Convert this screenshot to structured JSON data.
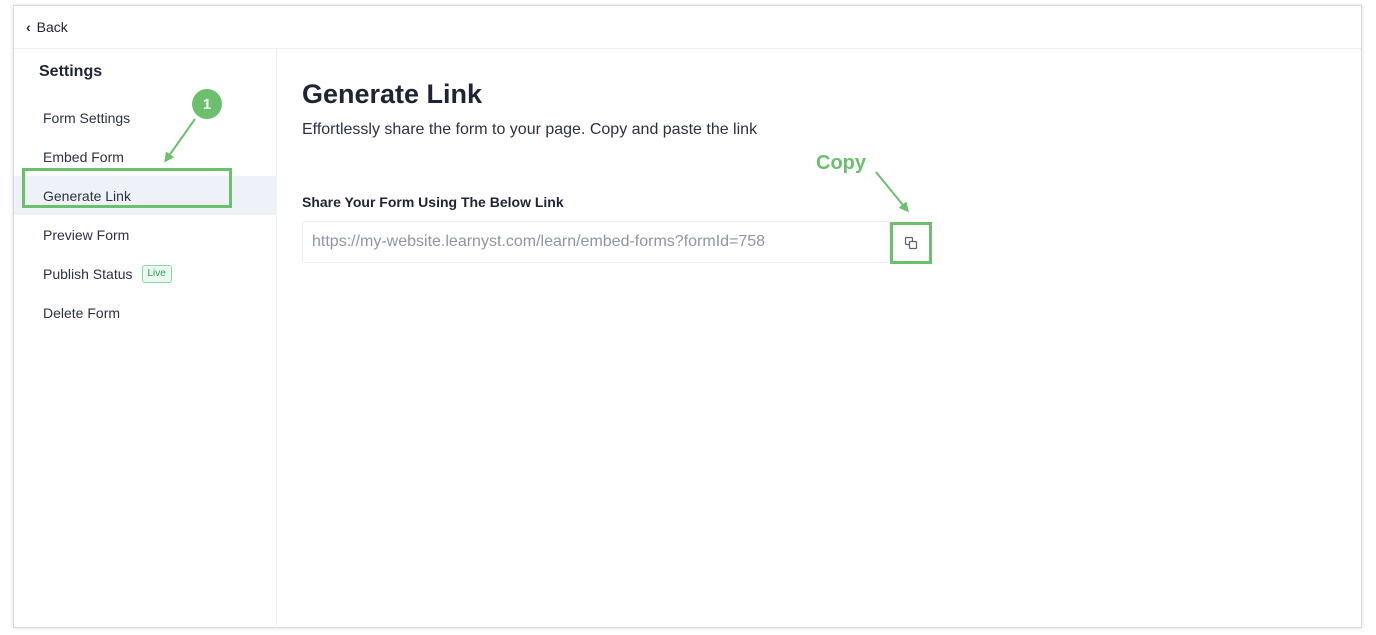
{
  "topbar": {
    "back_label": "Back"
  },
  "sidebar": {
    "title": "Settings",
    "items": [
      {
        "label": "Form Settings"
      },
      {
        "label": "Embed Form"
      },
      {
        "label": "Generate Link"
      },
      {
        "label": "Preview Form"
      },
      {
        "label": "Publish Status",
        "badge": "Live"
      },
      {
        "label": "Delete Form"
      }
    ],
    "active_item": "Generate Link"
  },
  "main": {
    "title": "Generate Link",
    "subtitle": "Effortlessly share the form to your page. Copy and paste the link",
    "field_label": "Share Your Form Using The Below Link",
    "link_value": "https://my-website.learnyst.com/learn/embed-forms?formId=758"
  },
  "annotations": {
    "step_number": "1",
    "copy_label": "Copy",
    "color": "#6cbf6d"
  }
}
